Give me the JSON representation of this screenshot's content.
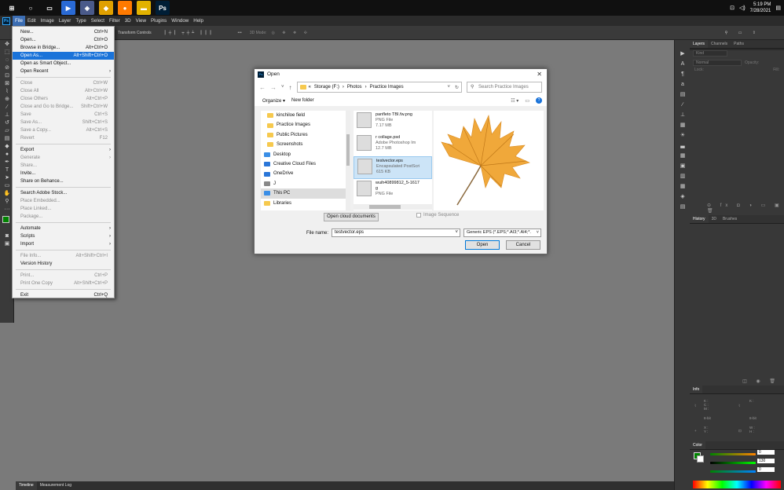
{
  "taskbar": {
    "apps": [
      {
        "name": "start",
        "color": "#101010",
        "glyph": "⊞"
      },
      {
        "name": "search",
        "color": "#101010",
        "glyph": "○"
      },
      {
        "name": "task-view",
        "color": "#101010",
        "glyph": "▭"
      },
      {
        "name": "media",
        "color": "#2a6ad4",
        "glyph": "▶"
      },
      {
        "name": "3d-viewer",
        "color": "#4a5a8a",
        "glyph": "◈"
      },
      {
        "name": "editor",
        "color": "#e0a000",
        "glyph": "◆"
      },
      {
        "name": "firefox",
        "color": "#ff7a00",
        "glyph": "●"
      },
      {
        "name": "explorer",
        "color": "#e2b200",
        "glyph": "▬"
      },
      {
        "name": "photoshop",
        "color": "#001e36",
        "glyph": "Ps"
      }
    ],
    "time": "5:19 PM",
    "date": "7/28/2021"
  },
  "menubar": {
    "items": [
      "File",
      "Edit",
      "Image",
      "Layer",
      "Type",
      "Select",
      "Filter",
      "3D",
      "View",
      "Plugins",
      "Window",
      "Help"
    ]
  },
  "options": {
    "transform_controls": "Transform Controls",
    "mode_3d": "3D Mode:"
  },
  "file_menu": {
    "groups": [
      [
        {
          "label": "New...",
          "shortcut": "Ctrl+N",
          "disabled": false
        },
        {
          "label": "Open...",
          "shortcut": "Ctrl+O",
          "disabled": false
        },
        {
          "label": "Browse in Bridge...",
          "shortcut": "Alt+Ctrl+O",
          "disabled": false
        },
        {
          "label": "Open As...",
          "shortcut": "Alt+Shift+Ctrl+O",
          "disabled": false,
          "highlight": true
        },
        {
          "label": "Open as Smart Object...",
          "shortcut": "",
          "disabled": false
        },
        {
          "label": "Open Recent",
          "shortcut": "",
          "disabled": false,
          "submenu": true
        }
      ],
      [
        {
          "label": "Close",
          "shortcut": "Ctrl+W",
          "disabled": true
        },
        {
          "label": "Close All",
          "shortcut": "Alt+Ctrl+W",
          "disabled": true
        },
        {
          "label": "Close Others",
          "shortcut": "Alt+Ctrl+P",
          "disabled": true
        },
        {
          "label": "Close and Go to Bridge...",
          "shortcut": "Shift+Ctrl+W",
          "disabled": true
        },
        {
          "label": "Save",
          "shortcut": "Ctrl+S",
          "disabled": true
        },
        {
          "label": "Save As...",
          "shortcut": "Shift+Ctrl+S",
          "disabled": true
        },
        {
          "label": "Save a Copy...",
          "shortcut": "Alt+Ctrl+S",
          "disabled": true
        },
        {
          "label": "Revert",
          "shortcut": "F12",
          "disabled": true
        }
      ],
      [
        {
          "label": "Export",
          "shortcut": "",
          "disabled": false,
          "submenu": true
        },
        {
          "label": "Generate",
          "shortcut": "",
          "disabled": true,
          "submenu": true
        },
        {
          "label": "Share...",
          "shortcut": "",
          "disabled": true
        },
        {
          "label": "Invite...",
          "shortcut": "",
          "disabled": false
        },
        {
          "label": "Share on Behance...",
          "shortcut": "",
          "disabled": false
        }
      ],
      [
        {
          "label": "Search Adobe Stock...",
          "shortcut": "",
          "disabled": false
        },
        {
          "label": "Place Embedded...",
          "shortcut": "",
          "disabled": true
        },
        {
          "label": "Place Linked...",
          "shortcut": "",
          "disabled": true
        },
        {
          "label": "Package...",
          "shortcut": "",
          "disabled": true
        }
      ],
      [
        {
          "label": "Automate",
          "shortcut": "",
          "disabled": false,
          "submenu": true
        },
        {
          "label": "Scripts",
          "shortcut": "",
          "disabled": false,
          "submenu": true
        },
        {
          "label": "Import",
          "shortcut": "",
          "disabled": false,
          "submenu": true
        }
      ],
      [
        {
          "label": "File Info...",
          "shortcut": "Alt+Shift+Ctrl+I",
          "disabled": true
        },
        {
          "label": "Version History",
          "shortcut": "",
          "disabled": false
        }
      ],
      [
        {
          "label": "Print...",
          "shortcut": "Ctrl+P",
          "disabled": true
        },
        {
          "label": "Print One Copy",
          "shortcut": "Alt+Shift+Ctrl+P",
          "disabled": true
        }
      ],
      [
        {
          "label": "Exit",
          "shortcut": "Ctrl+Q",
          "disabled": false
        }
      ]
    ]
  },
  "dialog": {
    "title": "Open",
    "breadcrumb": [
      "«",
      "Storage (F:)",
      "›",
      "Photos",
      "›",
      "Practice Images"
    ],
    "search_placeholder": "Search Practice Images",
    "organize": "Organize ▾",
    "new_folder": "New folder",
    "nav_items": [
      {
        "label": "kinchiloe field",
        "icon": "folder",
        "selected": false
      },
      {
        "label": "Practice Images",
        "icon": "folder",
        "selected": false
      },
      {
        "label": "Public Pictures",
        "icon": "folder",
        "selected": false
      },
      {
        "label": "Screenshots",
        "icon": "folder",
        "selected": false
      },
      {
        "label": "Desktop",
        "icon": "desktop",
        "selected": false
      },
      {
        "label": "Creative Cloud Files",
        "icon": "cloud",
        "selected": false
      },
      {
        "label": "OneDrive",
        "icon": "cloud",
        "selected": false
      },
      {
        "label": "J",
        "icon": "user",
        "selected": false
      },
      {
        "label": "This PC",
        "icon": "pc",
        "selected": true
      },
      {
        "label": "Libraries",
        "icon": "library",
        "selected": false
      }
    ],
    "files": [
      {
        "name": "panfleto TBI.fw.png",
        "type": "PNG File",
        "size": "7.17 MB",
        "selected": false
      },
      {
        "name": "r collage.psd",
        "type": "Adobe Photoshop Im",
        "size": "12.7 MB",
        "selected": false
      },
      {
        "name": "testvector.eps",
        "type": "Encapsulated PostScri",
        "size": "615 KB",
        "selected": true
      },
      {
        "name": "wuih40899812_5-1617",
        "name2": "g",
        "type": "PNG File",
        "size": "",
        "selected": false
      }
    ],
    "open_cloud": "Open cloud documents",
    "image_sequence": "Image Sequence",
    "file_name_label": "File name:",
    "file_name_value": "testvector.eps",
    "file_type": "Generic EPS (*.EPS;*.AI3;*.AI4;*.",
    "open_btn": "Open",
    "cancel_btn": "Cancel"
  },
  "panels": {
    "layers_tabs": [
      "Layers",
      "Channels",
      "Paths"
    ],
    "kind": "Kind",
    "blend": "Normal",
    "opacity": "Opacity:",
    "lock": "Lock:",
    "fill": "Fill:",
    "history_tabs": [
      "History",
      "3D",
      "Brushes"
    ],
    "info_title": "Info",
    "info_labels": {
      "k": "K :",
      "c": "C :",
      "m": "M :",
      "y": "Y :",
      "x": "X :",
      "yc": "Y :",
      "w": "W :",
      "h": "H :",
      "bit1": "8-bit",
      "bit2": "8-bit"
    },
    "color_title": "Color",
    "color_values": {
      "r": "0",
      "g": "130",
      "b": "0"
    }
  },
  "bottom_tabs": [
    "Timeline",
    "Measurement Log"
  ],
  "colors": {
    "foreground": "#008200",
    "background": "#ffffff",
    "accent": "#1a73d9"
  }
}
